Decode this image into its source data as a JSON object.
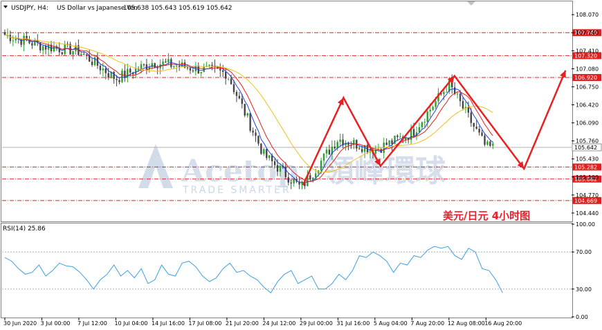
{
  "header": {
    "symbol": "USDJPY, H4:",
    "description": "US Dollar vs Japanese Yen",
    "ohlc": "105.638 105.643 105.619 105.642"
  },
  "watermark": {
    "brand_latin": "Acetop",
    "brand_cjk": "領峰環球",
    "tagline": "TRADE SMARTER"
  },
  "caption": "美元/日元  4小时图",
  "colors": {
    "bull": "#2ca02c",
    "bear": "#444444",
    "ma_fast": "#2040e0",
    "ma_mid": "#e02020",
    "ma_slow": "#f0c020",
    "level_line": "#e02020",
    "arrow": "#e82020",
    "rsi_line": "#3aa0e0"
  },
  "chart_data": [
    {
      "type": "candlestick",
      "name": "USDJPY H4",
      "ylim": [
        104.3,
        108.3
      ],
      "y_ticks": [
        "108.070",
        "107.740",
        "107.410",
        "107.080",
        "106.750",
        "106.420",
        "106.090",
        "105.760",
        "105.430",
        "105.100",
        "104.770",
        "104.440"
      ],
      "x_tick_labels": [
        "30 Jun 2020",
        "3 Jul 00:00",
        "7 Jul 12:00",
        "10 Jul 04:00",
        "14 Jul 16:00",
        "17 Jul 08:00",
        "21 Jul 20:00",
        "24 Jul 12:00",
        "29 Jul 00:00",
        "31 Jul 16:00",
        "5 Aug 04:00",
        "7 Aug 20:00",
        "12 Aug 08:00",
        "16 Aug 20:00"
      ],
      "horizontal_levels": [
        {
          "label": "107.740",
          "value": 107.74
        },
        {
          "label": "107.320",
          "value": 107.32
        },
        {
          "label": "106.920",
          "value": 106.92
        },
        {
          "label": "105.282",
          "value": 105.282
        },
        {
          "label": "105.062",
          "value": 105.062
        },
        {
          "label": "104.669",
          "value": 104.669
        }
      ],
      "current_price": {
        "label": "105.642",
        "value": 105.642
      },
      "key_closes": [
        {
          "x": "30 Jun 2020",
          "y": 107.7
        },
        {
          "x": "3 Jul 00:00",
          "y": 107.5
        },
        {
          "x": "7 Jul 12:00",
          "y": 107.4
        },
        {
          "x": "10 Jul 04:00",
          "y": 106.9
        },
        {
          "x": "14 Jul 16:00",
          "y": 107.2
        },
        {
          "x": "17 Jul 08:00",
          "y": 107.1
        },
        {
          "x": "21 Jul 20:00",
          "y": 107.0
        },
        {
          "x": "24 Jul 12:00",
          "y": 105.5
        },
        {
          "x": "29 Jul 00:00",
          "y": 104.9
        },
        {
          "x": "31 Jul 16:00",
          "y": 105.8
        },
        {
          "x": "5 Aug 04:00",
          "y": 105.6
        },
        {
          "x": "7 Aug 20:00",
          "y": 105.9
        },
        {
          "x": "12 Aug 08:00",
          "y": 106.8
        },
        {
          "x": "16 Aug 20:00",
          "y": 105.64
        }
      ],
      "annotation_path": [
        {
          "x": "29 Jul 00:00",
          "y": 104.95
        },
        {
          "x": "31 Jul 16:00",
          "y": 106.55
        },
        {
          "x": "5 Aug 04:00",
          "y": 105.3
        },
        {
          "x": "12 Aug 08:00",
          "y": 106.95
        },
        {
          "x": "16 Aug 20:00",
          "y": 105.25
        },
        {
          "x": "",
          "y": 107.05
        }
      ]
    },
    {
      "type": "line",
      "name": "RSI(14)",
      "label": "RSI(14) 25.86",
      "ylim": [
        0,
        100
      ],
      "y_ticks": [
        "100.00",
        "70.00",
        "30.00",
        "0.00"
      ],
      "levels": [
        70,
        30
      ],
      "last_value": 25.86,
      "values": [
        64,
        60,
        52,
        46,
        48,
        56,
        44,
        50,
        58,
        55,
        54,
        48,
        40,
        30,
        40,
        46,
        56,
        44,
        50,
        42,
        52,
        36,
        40,
        56,
        46,
        44,
        58,
        60,
        54,
        44,
        38,
        42,
        52,
        58,
        48,
        50,
        44,
        40,
        32,
        26,
        38,
        46,
        50,
        36,
        40,
        44,
        30,
        30,
        36,
        46,
        40,
        50,
        66,
        64,
        70,
        66,
        60,
        48,
        58,
        56,
        66,
        64,
        72,
        76,
        74,
        76,
        66,
        62,
        74,
        70,
        52,
        50,
        40,
        26
      ]
    }
  ]
}
